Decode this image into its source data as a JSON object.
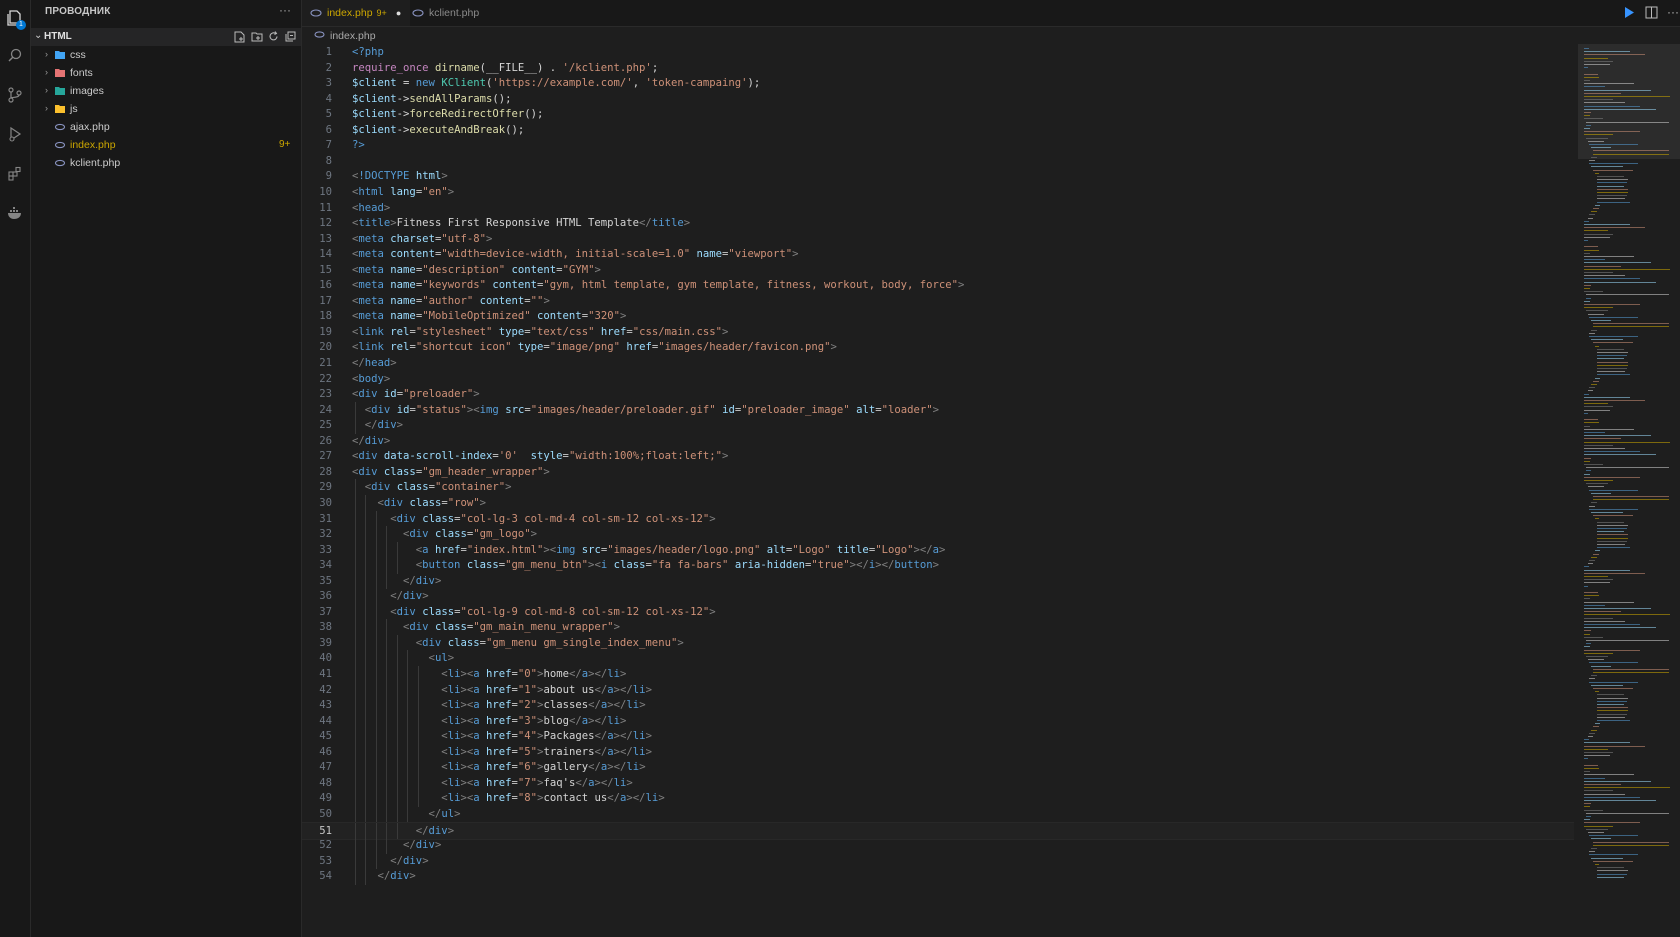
{
  "sidebar": {
    "title": "ПРОВОДНИК",
    "more": "···",
    "root": "HTML",
    "items": [
      {
        "label": "css",
        "type": "folder"
      },
      {
        "label": "fonts",
        "type": "folder"
      },
      {
        "label": "images",
        "type": "folder"
      },
      {
        "label": "js",
        "type": "folder"
      },
      {
        "label": "ajax.php",
        "type": "file"
      },
      {
        "label": "index.php",
        "type": "file",
        "badge": "9+"
      },
      {
        "label": "kclient.php",
        "type": "file"
      }
    ]
  },
  "tabs": [
    {
      "label": "index.php",
      "badge": "9+",
      "modified": "●"
    },
    {
      "label": "kclient.php"
    }
  ],
  "breadcrumb": "index.php",
  "activity_badge": "1",
  "colors": {
    "tag": "#569cd6",
    "attr": "#9cdcfe",
    "string": "#ce9178",
    "warning": "#cca700"
  },
  "editor": {
    "current_line": 51,
    "lines": [
      "<?php",
      "require_once dirname(__FILE__) . '/kclient.php';",
      "$client = new KClient('https://example.com/', 'token-campaing');",
      "$client->sendAllParams();",
      "$client->forceRedirectOffer();",
      "$client->executeAndBreak();",
      "?>",
      "",
      "<!DOCTYPE html>",
      "<html lang=\"en\">",
      "<head>",
      "<title>Fitness First Responsive HTML Template</title>",
      "<meta charset=\"utf-8\">",
      "<meta content=\"width=device-width, initial-scale=1.0\" name=\"viewport\">",
      "<meta name=\"description\" content=\"GYM\">",
      "<meta name=\"keywords\" content=\"gym, html template, gym template, fitness, workout, body, force\">",
      "<meta name=\"author\" content=\"\">",
      "<meta name=\"MobileOptimized\" content=\"320\">",
      "<link rel=\"stylesheet\" type=\"text/css\" href=\"css/main.css\">",
      "<link rel=\"shortcut icon\" type=\"image/png\" href=\"images/header/favicon.png\">",
      "</head>",
      "<body>",
      "<div id=\"preloader\">",
      "  <div id=\"status\"><img src=\"images/header/preloader.gif\" id=\"preloader_image\" alt=\"loader\">",
      "  </div>",
      "</div>",
      "<div data-scroll-index='0'  style=\"width:100%;float:left;\">",
      "<div class=\"gm_header_wrapper\">",
      "  <div class=\"container\">",
      "    <div class=\"row\">",
      "      <div class=\"col-lg-3 col-md-4 col-sm-12 col-xs-12\">",
      "        <div class=\"gm_logo\">",
      "          <a href=\"index.html\"><img src=\"images/header/logo.png\" alt=\"Logo\" title=\"Logo\"></a>",
      "          <button class=\"gm_menu_btn\"><i class=\"fa fa-bars\" aria-hidden=\"true\"></i></button>",
      "        </div>",
      "      </div>",
      "      <div class=\"col-lg-9 col-md-8 col-sm-12 col-xs-12\">",
      "        <div class=\"gm_main_menu_wrapper\">",
      "          <div class=\"gm_menu gm_single_index_menu\">",
      "            <ul>",
      "              <li><a href=\"0\">home</a></li>",
      "              <li><a href=\"1\">about us</a></li>",
      "              <li><a href=\"2\">classes</a></li>",
      "              <li><a href=\"3\">blog</a></li>",
      "              <li><a href=\"4\">Packages</a></li>",
      "              <li><a href=\"5\">trainers</a></li>",
      "              <li><a href=\"6\">gallery</a></li>",
      "              <li><a href=\"7\">faq's</a></li>",
      "              <li><a href=\"8\">contact us</a></li>",
      "            </ul>",
      "          </div>",
      "        </div>",
      "      </div>",
      "    </div>"
    ]
  }
}
